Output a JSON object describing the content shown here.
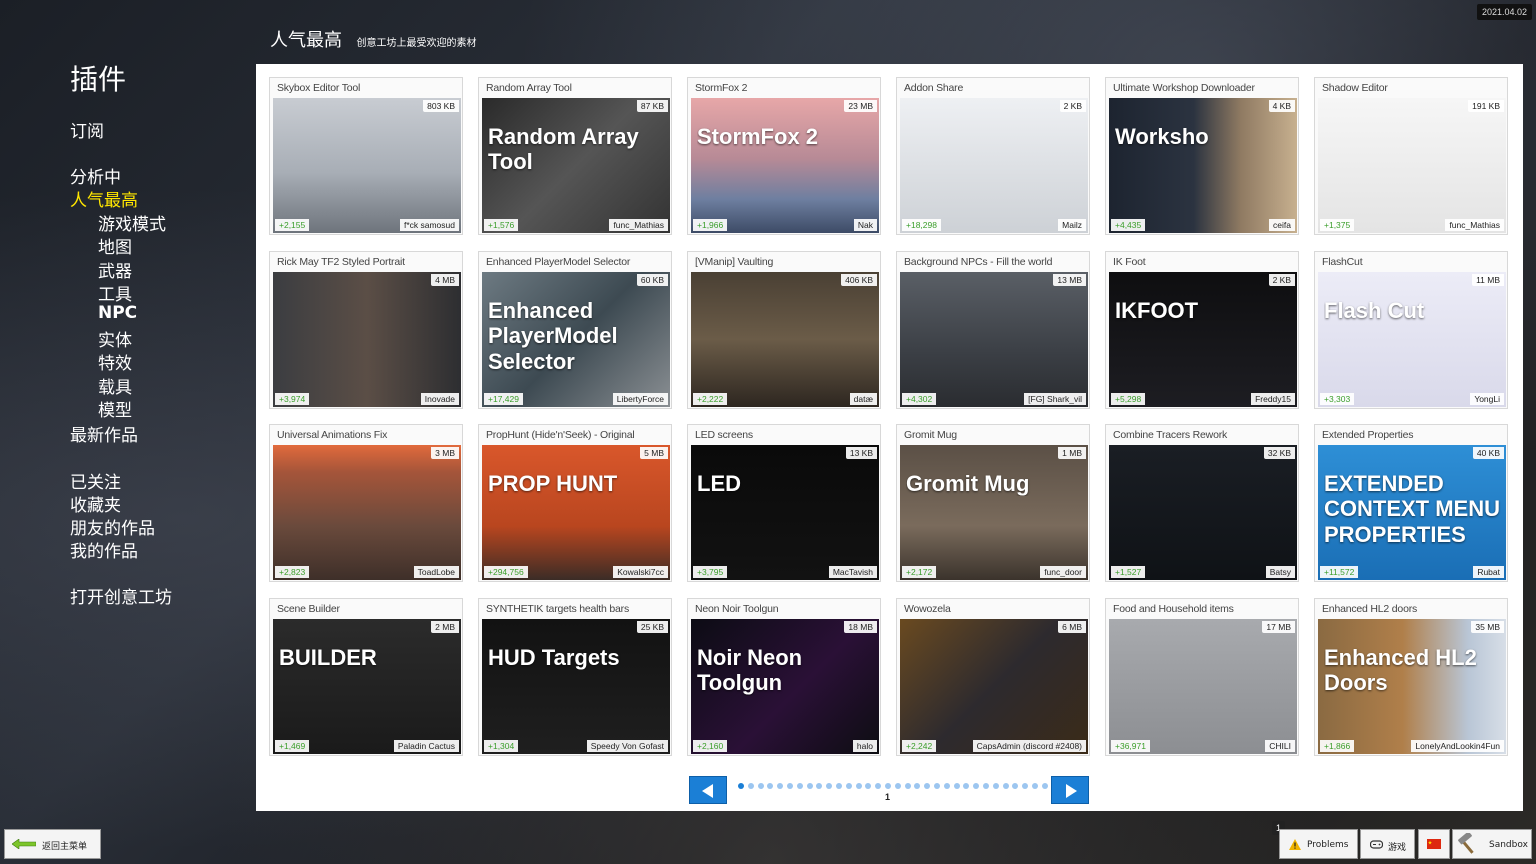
{
  "version": "2021.04.02",
  "sidebar": {
    "title": "插件",
    "subscribed": "订阅",
    "analyzing": "分析中",
    "popular": "人气最高",
    "subcats": [
      "游戏模式",
      "地图",
      "武器",
      "工具",
      "NPC",
      "实体",
      "特效",
      "载具",
      "模型"
    ],
    "latest": "最新作品",
    "followed": "已关注",
    "favorites": "收藏夹",
    "friends": "朋友的作品",
    "mine": "我的作品",
    "open_workshop": "打开创意工坊"
  },
  "header": {
    "title": "人气最高",
    "subtitle": "创意工坊上最受欢迎的素材"
  },
  "colors": {
    "accent": "#1b7fd6",
    "active": "#ffe600",
    "votes": "#3a9e2a"
  },
  "addons": [
    {
      "title": "Skybox Editor Tool",
      "size": "803 KB",
      "votes": "+2,155",
      "author": "f*ck samosud",
      "thumb": "",
      "bg": "linear-gradient(180deg,#c8ccd2 0%,#a8aeb6 55%,#6e747c 100%)"
    },
    {
      "title": "Random Array Tool",
      "size": "87 KB",
      "votes": "+1,576",
      "author": "func_Mathias",
      "thumb": "Random Array Tool",
      "bg": "linear-gradient(135deg,#2a2a2a,#555 50%,#333)"
    },
    {
      "title": "StormFox 2",
      "size": "23 MB",
      "votes": "+1,966",
      "author": "Nak",
      "thumb": "StormFox 2",
      "bg": "linear-gradient(180deg,#e7a7a8 0%,#b78a96 45%,#6e7fa0 75%,#3d4b66 100%)"
    },
    {
      "title": "Addon Share",
      "size": "2 KB",
      "votes": "+18,298",
      "author": "Mailz",
      "thumb": "",
      "bg": "linear-gradient(180deg,#eef0f3,#cdd1d6)"
    },
    {
      "title": "Ultimate Workshop Downloader",
      "size": "4 KB",
      "votes": "+4,435",
      "author": "ceifa",
      "thumb": "Worksho",
      "bg": "linear-gradient(90deg,#1d2430 0%,#2b3340 45%,#8f7a62 70%,#c7b08f 100%)"
    },
    {
      "title": "Shadow Editor",
      "size": "191 KB",
      "votes": "+1,375",
      "author": "func_Mathias",
      "thumb": "",
      "bg": "linear-gradient(180deg,#f6f6f6,#e4e4e4)"
    },
    {
      "title": "Rick May TF2 Styled Portrait",
      "size": "4 MB",
      "votes": "+3,974",
      "author": "Inovade",
      "thumb": "",
      "bg": "linear-gradient(90deg,#3b3d41,#5b4e46 50%,#2d2e31)"
    },
    {
      "title": "Enhanced PlayerModel Selector",
      "size": "60 KB",
      "votes": "+17,429",
      "author": "LibertyForce",
      "thumb": "Enhanced PlayerModel Selector",
      "bg": "linear-gradient(135deg,#6d7a82,#3d4a52 50%,#8a8f93)"
    },
    {
      "title": "[VManip] Vaulting",
      "size": "406 KB",
      "votes": "+2,222",
      "author": "datæ",
      "thumb": "",
      "bg": "linear-gradient(180deg,#4a4034,#6b5c48 50%,#2d2620)"
    },
    {
      "title": "Background NPCs - Fill the world",
      "size": "13 MB",
      "votes": "+4,302",
      "author": "[FG] Shark_vil",
      "thumb": "",
      "bg": "linear-gradient(180deg,#5a5f66,#3b3f45 60%,#2a2c30)"
    },
    {
      "title": "IK Foot",
      "size": "2 KB",
      "votes": "+5,298",
      "author": "Freddy15",
      "thumb": "IKFOOT",
      "bg": "linear-gradient(180deg,#0e0e10,#1d1d22)"
    },
    {
      "title": "FlashCut",
      "size": "11 MB",
      "votes": "+3,303",
      "author": "YongLi",
      "thumb": "Flash Cut",
      "bg": "linear-gradient(180deg,#ececf7,#d9d9ea)"
    },
    {
      "title": "Universal Animations Fix",
      "size": "3 MB",
      "votes": "+2,823",
      "author": "ToadLobe",
      "thumb": "",
      "bg": "linear-gradient(180deg,#e16a3c 0%,#a5553a 20%,#6a4a3c 60%,#3e2f29 100%)"
    },
    {
      "title": "PropHunt (Hide'n'Seek) - Original",
      "size": "5 MB",
      "votes": "+294,756",
      "author": "Kowalski7cc",
      "thumb": "PROP HUNT",
      "bg": "linear-gradient(180deg,#d9572b,#b9461f 60%,#3b2c26)"
    },
    {
      "title": "LED screens",
      "size": "13 KB",
      "votes": "+3,795",
      "author": "MacTavish",
      "thumb": "LED",
      "bg": "linear-gradient(180deg,#0a0a0a,#121212)"
    },
    {
      "title": "Gromit Mug",
      "size": "1 MB",
      "votes": "+2,172",
      "author": "func_door",
      "thumb": "Gromit Mug",
      "bg": "linear-gradient(180deg,#5b5046,#7a6b5c 60%,#3b332c)"
    },
    {
      "title": "Combine Tracers Rework",
      "size": "32 KB",
      "votes": "+1,527",
      "author": "Batsy",
      "thumb": "",
      "bg": "linear-gradient(180deg,#1a1e24,#0f1216)"
    },
    {
      "title": "Extended Properties",
      "size": "40 KB",
      "votes": "+11,572",
      "author": "Rubat",
      "thumb": "EXTENDED CONTEXT MENU PROPERTIES",
      "bg": "linear-gradient(180deg,#2e8fd6,#1a6eb5)"
    },
    {
      "title": "Scene Builder",
      "size": "2 MB",
      "votes": "+1,469",
      "author": "Paladin Cactus",
      "thumb": "BUILDER",
      "bg": "linear-gradient(180deg,#2b2b2b,#1a1a1a)"
    },
    {
      "title": "SYNTHETIK targets health bars",
      "size": "25 KB",
      "votes": "+1,304",
      "author": "Speedy Von Gofast",
      "thumb": "HUD Targets",
      "bg": "linear-gradient(180deg,#121212,#1f1f1f)"
    },
    {
      "title": "Neon Noir Toolgun",
      "size": "18 MB",
      "votes": "+2,160",
      "author": "halo",
      "thumb": "Noir Neon Toolgun",
      "bg": "linear-gradient(135deg,#0c0c14,#2a1036 55%,#0d0d12)"
    },
    {
      "title": "Wowozela",
      "size": "6 MB",
      "votes": "+2,242",
      "author": "CapsAdmin (discord #2408)",
      "thumb": "",
      "bg": "linear-gradient(135deg,#6a4a20,#2d2a2e 50%,#3b2b18)"
    },
    {
      "title": "Food and Household items",
      "size": "17 MB",
      "votes": "+36,971",
      "author": "CHILI",
      "thumb": "",
      "bg": "linear-gradient(180deg,#a8aaae,#8c8e92)"
    },
    {
      "title": "Enhanced HL2 doors",
      "size": "35 MB",
      "votes": "+1,866",
      "author": "LonelyAndLookin4Fun",
      "thumb": "Enhanced HL2 Doors",
      "bg": "linear-gradient(90deg,#8a6a42 0%,#b07f4a 45%,#b9c6d6 80%,#d7dee7 100%)"
    }
  ],
  "pager": {
    "current": "1",
    "total_dots": 32
  },
  "footer": {
    "back_label": "返回主菜单",
    "notification_count": "1",
    "problems_label": "Problems",
    "game_label": "游戏",
    "sandbox_label": "Sandbox"
  }
}
